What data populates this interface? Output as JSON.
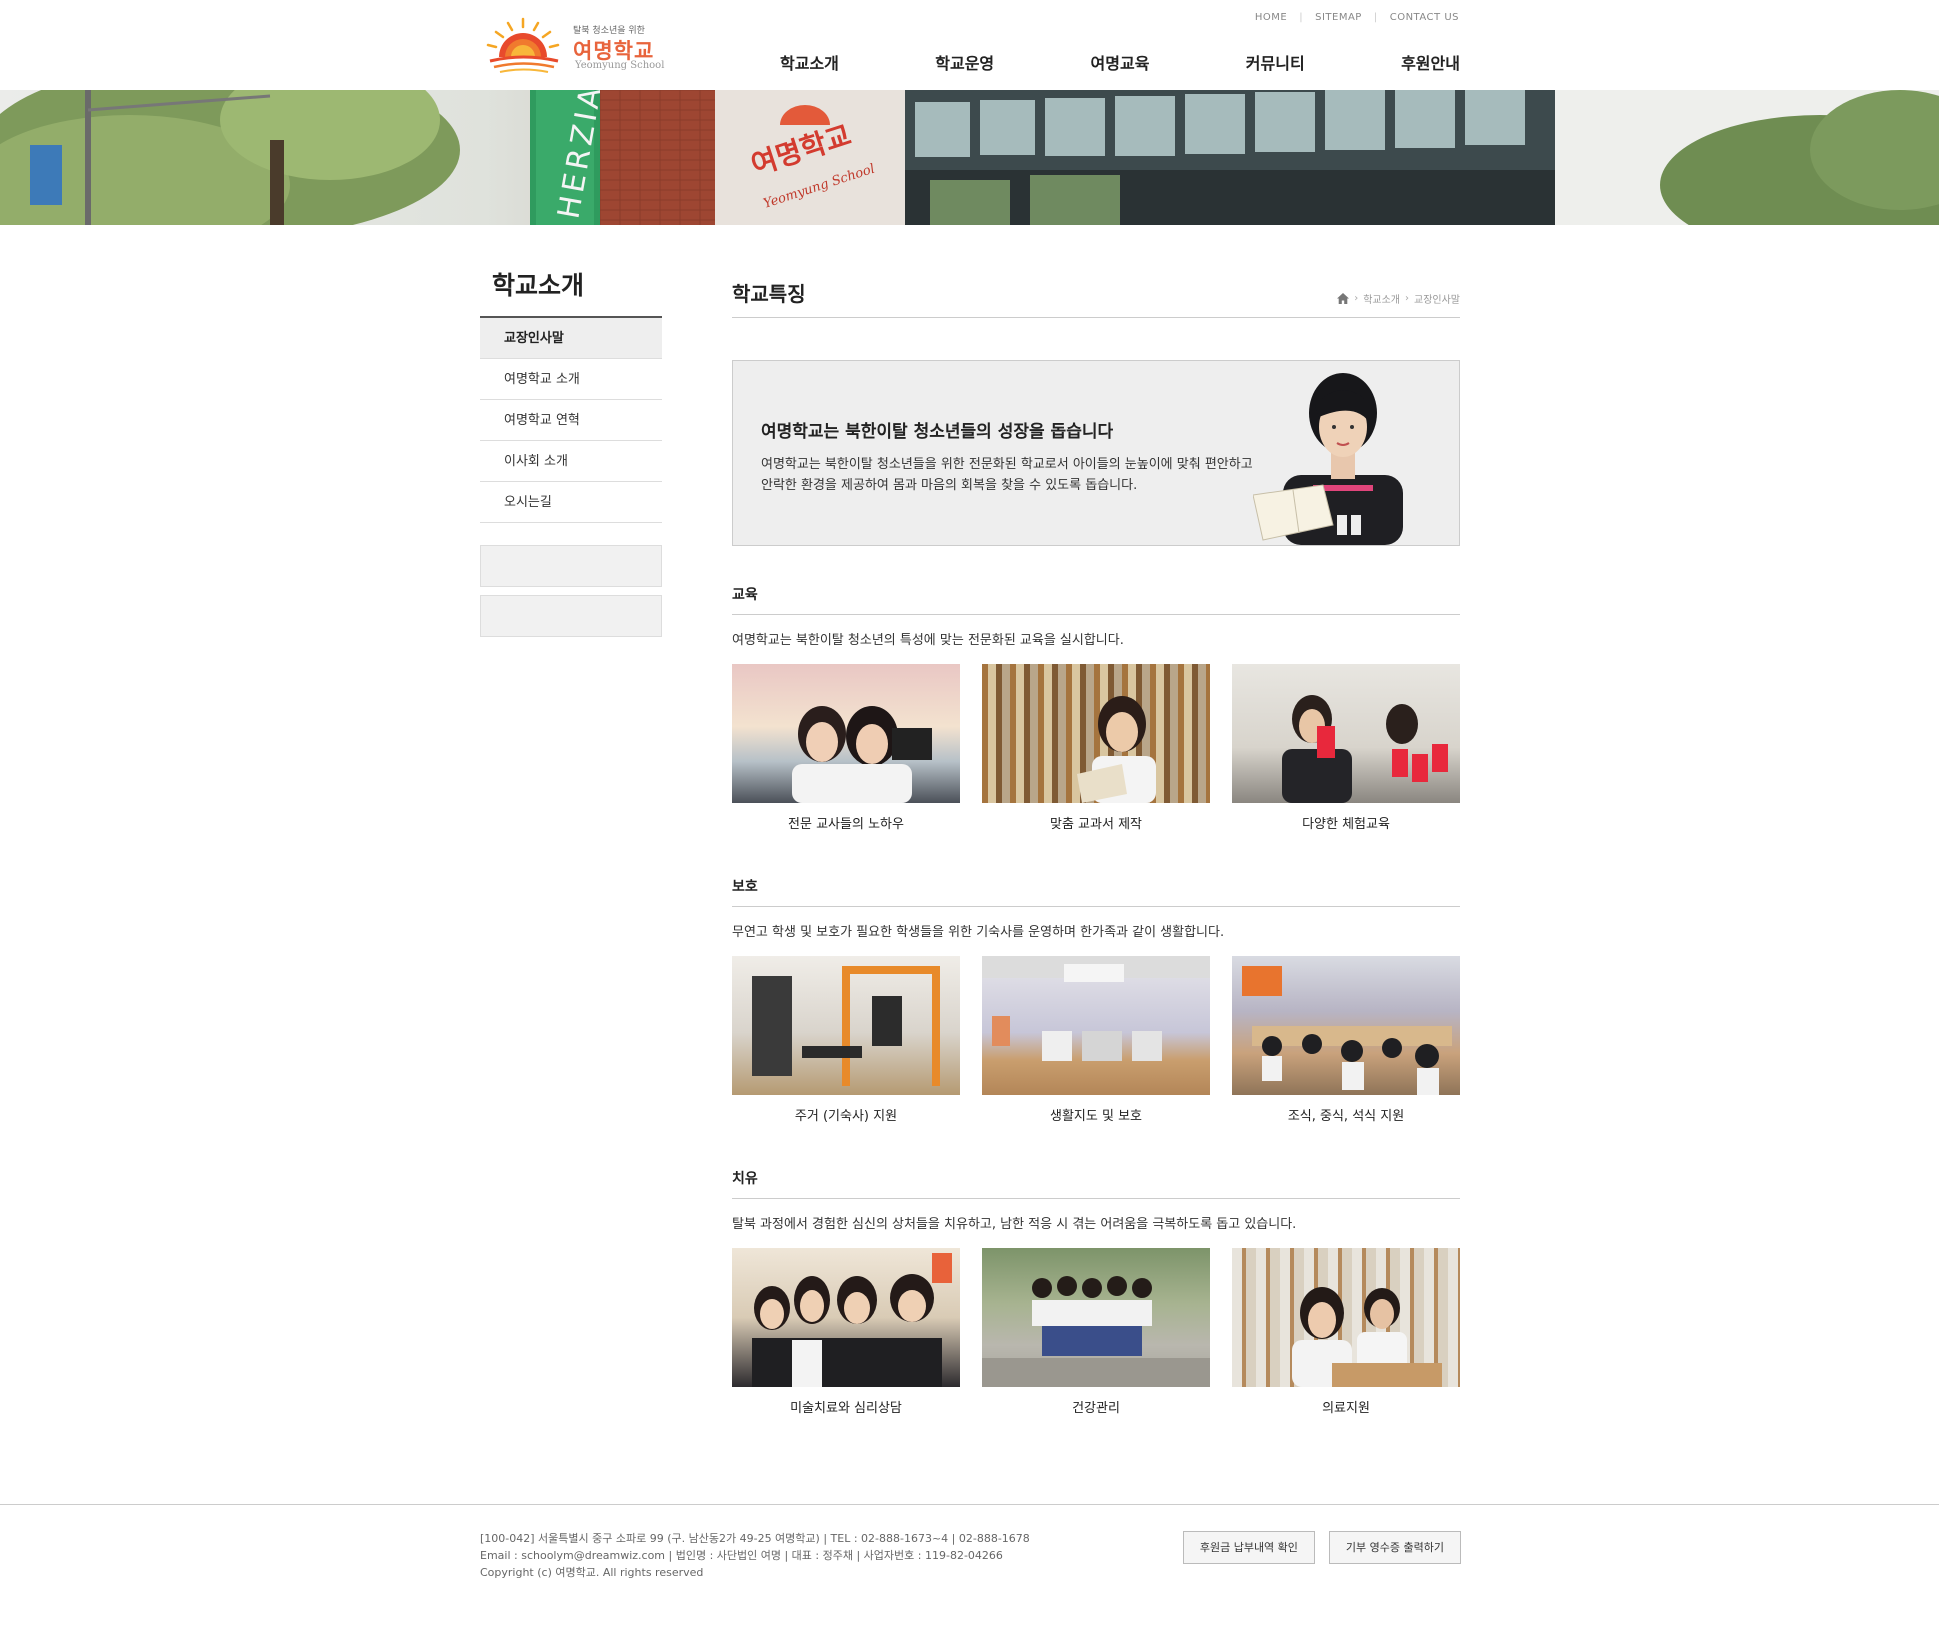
{
  "header": {
    "logo_tagline": "탈북 청소년을 위한",
    "logo_name": "여명학교",
    "logo_english": "Yeomyung School",
    "util": {
      "home": "HOME",
      "sitemap": "SITEMAP",
      "contact": "CONTACT US"
    },
    "nav": [
      "학교소개",
      "학교운영",
      "여명교육",
      "커뮤니티",
      "후원안내"
    ]
  },
  "banner": {
    "sign_korean": "여명학교",
    "sign_english": "Yeomyung School",
    "side_text": "HERZIA"
  },
  "sidebar": {
    "title": "학교소개",
    "items": [
      "교장인사말",
      "여명학교 소개",
      "여명학교 연혁",
      "이사회 소개",
      "오시는길"
    ]
  },
  "content": {
    "title": "학교특징",
    "breadcrumb": [
      "학교소개",
      "교장인사말"
    ],
    "intro": {
      "heading": "여명학교는 북한이탈 청소년들의 성장을 돕습니다",
      "text": "여명학교는 북한이탈 청소년들을 위한 전문화된 학교로서 아이들의 눈높이에 맞춰 편안하고 안락한 환경을 제공하여 몸과 마음의 회복을 찾을 수 있도록 돕습니다."
    },
    "sections": [
      {
        "title": "교육",
        "desc": "여명학교는 북한이탈 청소년의 특성에 맞는 전문화된 교육을 실시합니다.",
        "photos": [
          "전문 교사들의 노하우",
          "맞춤 교과서 제작",
          "다양한 체험교육"
        ]
      },
      {
        "title": "보호",
        "desc": "무연고 학생 및 보호가 필요한 학생들을 위한 기숙사를 운영하며 한가족과 같이 생활합니다.",
        "photos": [
          "주거 (기숙사) 지원",
          "생활지도 및 보호",
          "조식, 중식, 석식 지원"
        ]
      },
      {
        "title": "치유",
        "desc": "탈북 과정에서 경험한 심신의 상처들을 치유하고, 남한 적응 시 겪는 어려움을 극복하도록 돕고 있습니다.",
        "photos": [
          "미술치료와 심리상담",
          "건강관리",
          "의료지원"
        ]
      }
    ]
  },
  "footer": {
    "address": "[100-042] 서울특별시 중구 소파로 99 (구. 남산동2가 49-25 여명학교) | TEL : 02-888-1673~4 | 02-888-1678",
    "email": "Email : schoolym@dreamwiz.com | 법인명 : 사단법인 여명 | 대표 : 정주채 | 사업자번호 : 119-82-04266",
    "copyright": "Copyright (c) 여명학교. All rights reserved",
    "btn_history": "후원금 납부내역 확인",
    "btn_receipt": "기부 영수증 출력하기"
  },
  "colors": {
    "accent": "#e8643c",
    "text": "#222222",
    "panel": "#eeeeee"
  }
}
